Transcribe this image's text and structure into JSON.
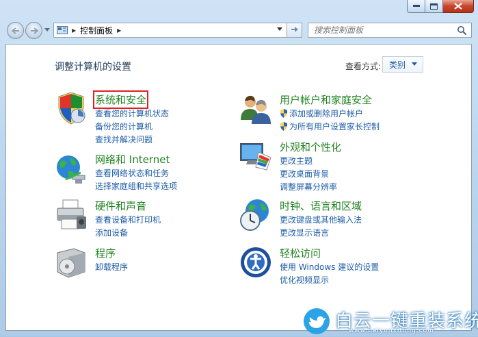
{
  "window": {
    "caption": {
      "minimize_label": "",
      "maximize_label": "",
      "close_label": ""
    }
  },
  "nav": {
    "address": {
      "segments": [
        "控制面板"
      ]
    },
    "search": {
      "placeholder": "搜索控制面板"
    }
  },
  "content": {
    "page_title": "调整计算机的设置",
    "view_by": {
      "label": "查看方式:",
      "value": "类别"
    },
    "categories": [
      {
        "title": "系统和安全",
        "icon": "shield-security-icon",
        "links": [
          "查看您的计算机状态",
          "备份您的计算机",
          "查找并解决问题"
        ],
        "highlighted": true
      },
      {
        "title": "网络和 Internet",
        "icon": "network-globe-icon",
        "links": [
          "查看网络状态和任务",
          "选择家庭组和共享选项"
        ]
      },
      {
        "title": "硬件和声音",
        "icon": "printer-icon",
        "links": [
          "查看设备和打印机",
          "添加设备"
        ]
      },
      {
        "title": "程序",
        "icon": "programs-box-icon",
        "links": [
          "卸载程序"
        ]
      },
      {
        "title": "用户帐户和家庭安全",
        "icon": "users-icon",
        "links": [
          "添加或删除用户帐户",
          "为所有用户设置家长控制"
        ]
      },
      {
        "title": "外观和个性化",
        "icon": "monitor-palette-icon",
        "links": [
          "更改主题",
          "更改桌面背景",
          "调整屏幕分辨率"
        ]
      },
      {
        "title": "时钟、语言和区域",
        "icon": "clock-globe-icon",
        "links": [
          "更改键盘或其他输入法",
          "更改显示语言"
        ]
      },
      {
        "title": "轻松访问",
        "icon": "ease-of-access-icon",
        "links": [
          "使用 Windows 建议的设置",
          "优化视频显示"
        ]
      }
    ]
  },
  "watermark": {
    "text": "白云一键重装系统",
    "url": "www.baiyunxitong.com"
  },
  "colors": {
    "category_title": "#1e8220",
    "link": "#1e5ca8",
    "highlight": "#e02020"
  }
}
